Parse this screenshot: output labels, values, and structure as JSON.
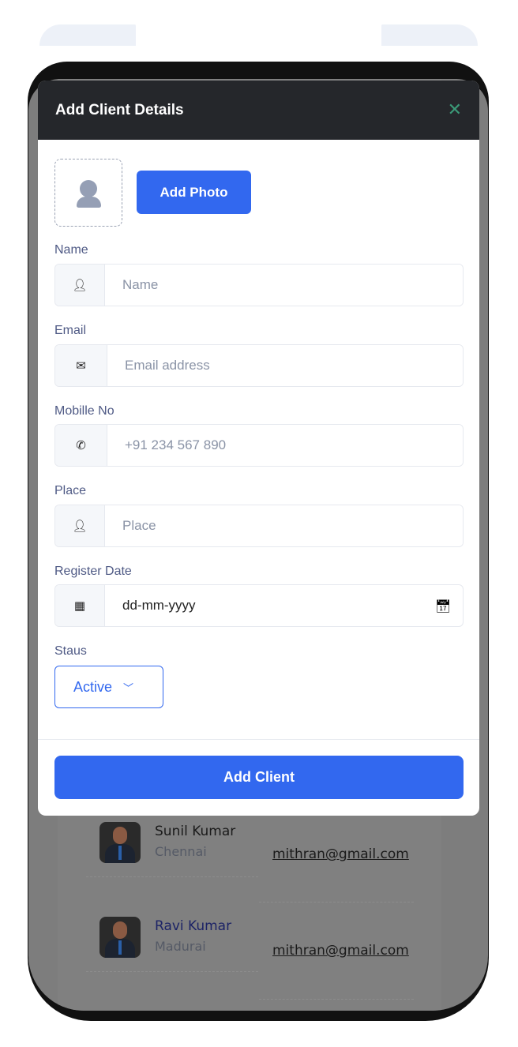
{
  "modal": {
    "title": "Add Client Details",
    "add_photo": "Add Photo",
    "submit": "Add Client",
    "fields": [
      {
        "label": "Name",
        "placeholder": "Name",
        "icon": "user-icon"
      },
      {
        "label": "Email",
        "placeholder": "Email address",
        "icon": "envelope-icon"
      },
      {
        "label": "Mobille No",
        "placeholder": "+91 234 567 890",
        "icon": "phone-icon"
      },
      {
        "label": "Place",
        "placeholder": "Place",
        "icon": "user-icon"
      },
      {
        "label": "Register Date",
        "value": "dd-mm-yyyy",
        "icon": "calendar-icon"
      }
    ],
    "status": {
      "label": "Staus",
      "value": "Active"
    }
  },
  "clients": [
    {
      "name": "Sunil Kumar",
      "place": "Chennai",
      "email": "mithran@gmail.com"
    },
    {
      "name": "Ravi Kumar",
      "place": "Madurai",
      "email": "mithran@gmail.com"
    }
  ],
  "colors": {
    "primary": "#3268ef",
    "header": "#25272b",
    "close": "#3b9a78"
  }
}
